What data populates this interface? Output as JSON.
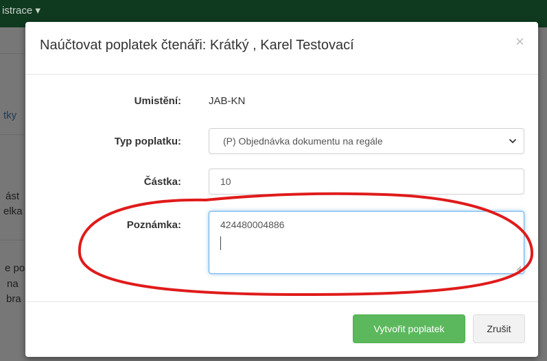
{
  "background": {
    "nav_fragment": "istrace ▾",
    "fragments": [
      "tky",
      "ást",
      "elka",
      "e po",
      "na",
      "bra"
    ]
  },
  "modal": {
    "title": "Naúčtovat poplatek čtenáři: Krátký , Karel Testovací",
    "close_symbol": "×",
    "fields": {
      "location_label": "Umistění:",
      "location_value": "JAB-KN",
      "fee_type_label": "Typ poplatku:",
      "fee_type_selected": "(P) Objednávka dokumentu na regále",
      "amount_label": "Částka:",
      "amount_value": "10",
      "note_label": "Poznámka:",
      "note_value": "424480004886"
    },
    "buttons": {
      "create": "Vytvořit poplatek",
      "cancel": "Zrušit"
    }
  },
  "colors": {
    "success": "#5cb85c",
    "focus_border": "#66afe9",
    "annotation": "#e01b1b",
    "topbar": "#0f3a1f"
  }
}
